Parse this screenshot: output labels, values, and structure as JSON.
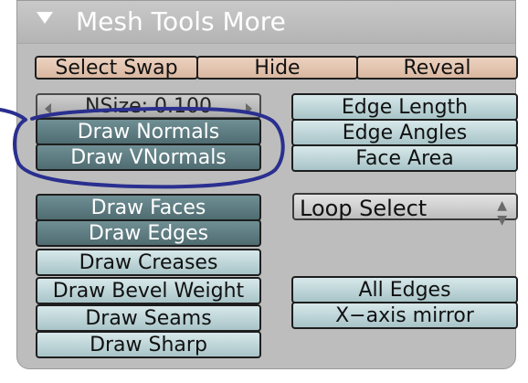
{
  "panel": {
    "title": "Mesh Tools More",
    "collapse_icon": "triangle-down-icon"
  },
  "toolbar": {
    "select_swap": "Select Swap",
    "hide": "Hide",
    "reveal": "Reveal"
  },
  "nsize": {
    "label": "NSize: 0.100"
  },
  "left_buttons": {
    "draw_normals": "Draw Normals",
    "draw_vnormals": "Draw VNormals",
    "draw_faces": "Draw Faces",
    "draw_edges": "Draw Edges",
    "draw_creases": "Draw Creases",
    "draw_bevel_weight": "Draw Bevel Weight",
    "draw_seams": "Draw Seams",
    "draw_sharp": "Draw Sharp"
  },
  "right_buttons": {
    "edge_length": "Edge Length",
    "edge_angles": "Edge Angles",
    "face_area": "Face Area",
    "all_edges": "All Edges",
    "x_axis_mirror": "X−axis mirror"
  },
  "loop_menu": {
    "selected": "Loop Select",
    "icon": "updown-arrows-icon"
  },
  "annotation": {
    "color": "#2a2f8f"
  }
}
